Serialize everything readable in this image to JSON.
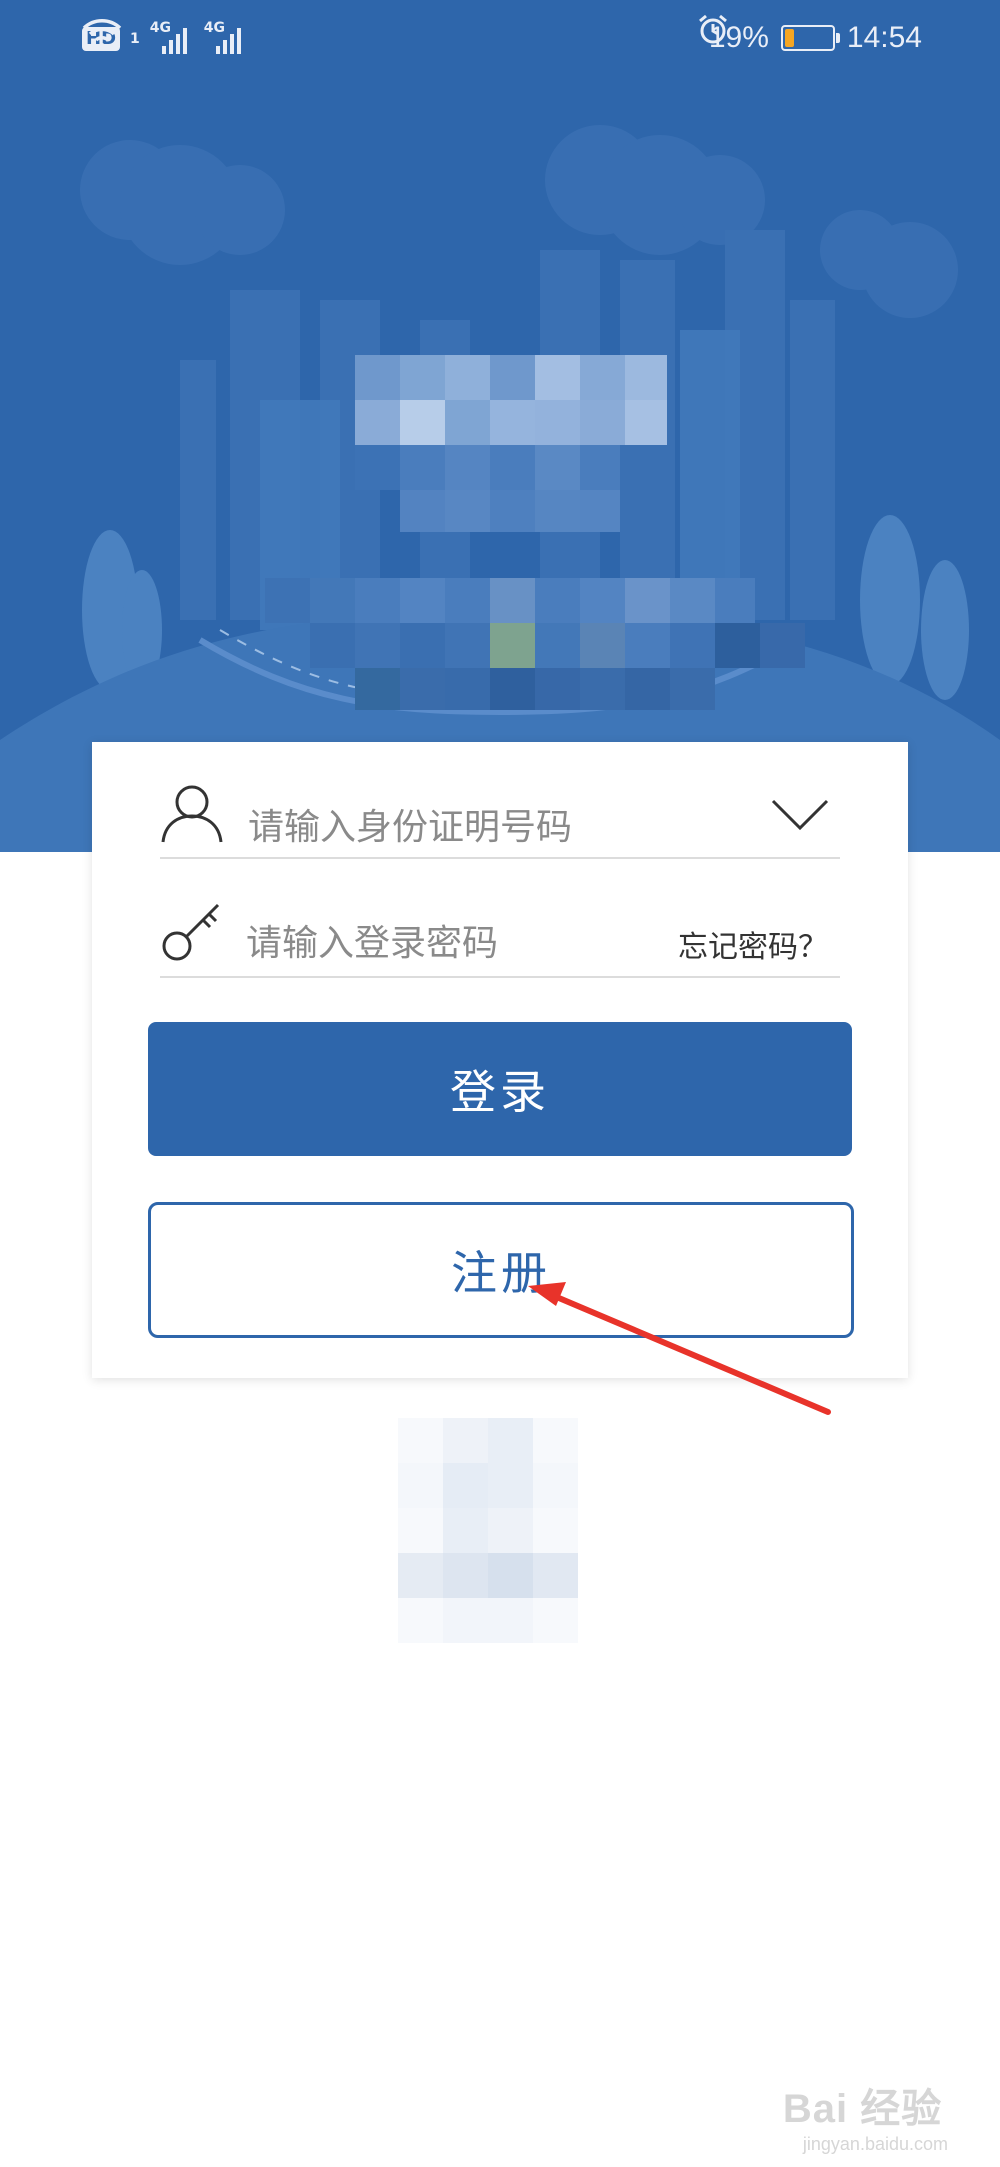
{
  "status_bar": {
    "left": {
      "hd": "HD",
      "sim": "1",
      "net1": "4G",
      "net2": "4G"
    },
    "right": {
      "battery_pct": "19%",
      "battery_level": 0.19,
      "time": "14:54"
    }
  },
  "login_form": {
    "id_placeholder": "请输入身份证明号码",
    "password_placeholder": "请输入登录密码",
    "forgot_password": "忘记密码？",
    "login_button": "登录",
    "register_button": "注册"
  },
  "watermark": {
    "main": "Bai 经验",
    "sub": "jingyan.baidu.com"
  },
  "colors": {
    "primary": "#2e66ab",
    "background": "#ffffff",
    "annotation_arrow": "#e8332a"
  }
}
